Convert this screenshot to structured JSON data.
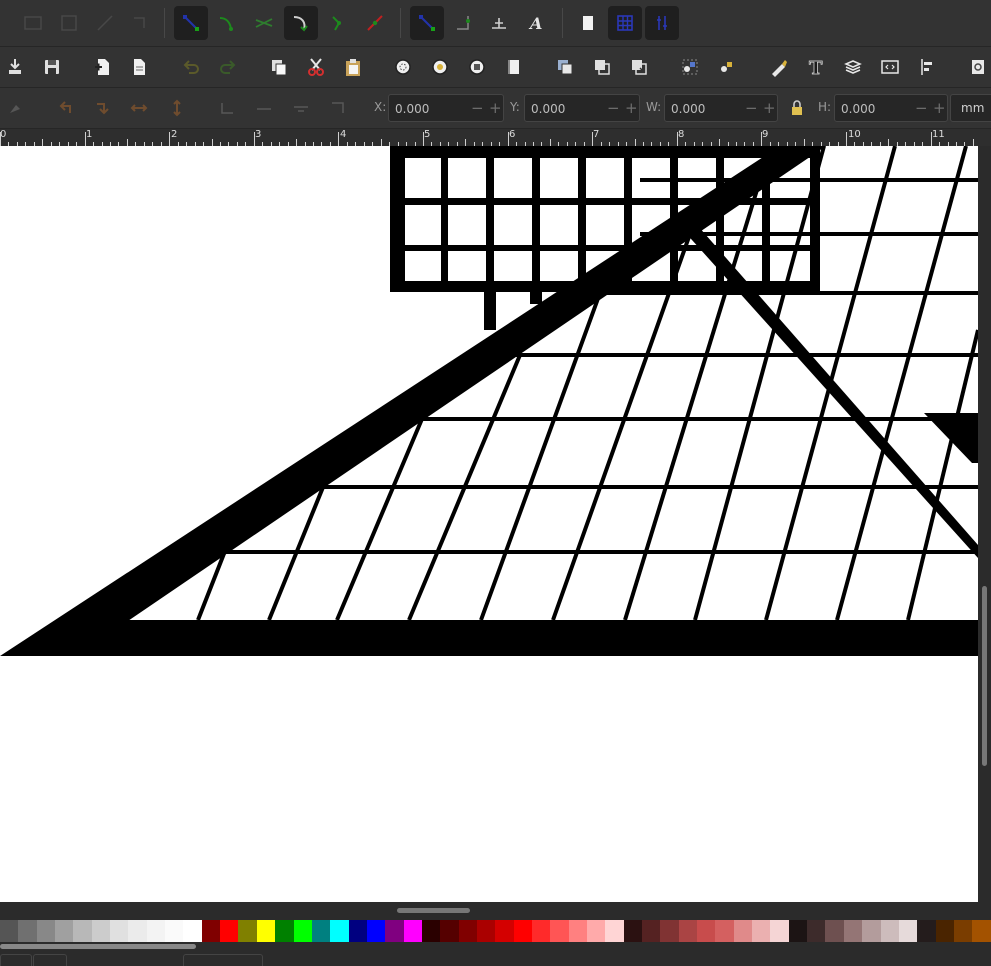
{
  "app": {
    "accent": "#1a237e"
  },
  "snap_toolbar": {
    "items": [
      {
        "icon": "snap-nodes-icon",
        "active": true
      },
      {
        "icon": "snap-smooth-icon",
        "active": false
      },
      {
        "icon": "snap-intersection-icon",
        "active": false
      },
      {
        "icon": "snap-path-icon",
        "active": true
      },
      {
        "icon": "snap-cusp-icon",
        "active": false
      },
      {
        "icon": "snap-midpoint-icon",
        "active": false
      },
      {
        "icon": "snap-bbox-icon",
        "active": true
      },
      {
        "icon": "snap-center-icon",
        "active": false
      },
      {
        "icon": "snap-rotation-center-icon",
        "active": false
      },
      {
        "icon": "snap-text-baseline-icon",
        "active": false
      },
      {
        "icon": "snap-page-icon",
        "active": false
      },
      {
        "icon": "snap-grid-icon",
        "active": true
      },
      {
        "icon": "snap-guide-icon",
        "active": true
      }
    ]
  },
  "command_toolbar": {
    "items": [
      "import-icon",
      "save-icon",
      "new-document-icon",
      "document-properties-icon",
      "undo-icon",
      "redo-icon",
      "copy-icon",
      "cut-icon",
      "paste-icon",
      "zoom-selection-icon",
      "zoom-drawing-icon",
      "zoom-page-icon",
      "zoom-page-width-icon",
      "duplicate-icon",
      "clone-icon",
      "unlink-clone-icon",
      "group-icon",
      "ungroup-icon",
      "fill-stroke-icon",
      "text-font-icon",
      "layers-icon",
      "xml-editor-icon",
      "align-distribute-icon",
      "preferences-icon"
    ]
  },
  "selector_toolbar": {
    "fields": [
      {
        "key": "x",
        "label": "X:",
        "value": "0.000"
      },
      {
        "key": "y",
        "label": "Y:",
        "value": "0.000"
      },
      {
        "key": "w",
        "label": "W:",
        "value": "0.000"
      },
      {
        "key": "h",
        "label": "H:",
        "value": "0.000"
      }
    ],
    "unit": "mm",
    "minus_label": "−",
    "plus_label": "+"
  },
  "ruler": {
    "labels": [
      "0",
      "1",
      "2",
      "3",
      "4",
      "5",
      "6",
      "7",
      "8",
      "9",
      "10",
      "11"
    ]
  },
  "palette": {
    "colors": [
      "#555555",
      "#707070",
      "#888888",
      "#a0a0a0",
      "#b8b8b8",
      "#cccccc",
      "#e0e0e0",
      "#ebebeb",
      "#f3f3f3",
      "#fafafa",
      "#ffffff",
      "#800000",
      "#ff0000",
      "#808000",
      "#ffff00",
      "#008000",
      "#00ff00",
      "#008080",
      "#00ffff",
      "#000080",
      "#0000ff",
      "#800080",
      "#ff00ff",
      "#2a0000",
      "#550000",
      "#800000",
      "#aa0000",
      "#d40000",
      "#ff0000",
      "#ff2a2a",
      "#ff5555",
      "#ff8080",
      "#ffaaaa",
      "#ffd5d5",
      "#2b1111",
      "#552222",
      "#803333",
      "#aa4444",
      "#c84c4c",
      "#d46060",
      "#e08a8a",
      "#ebb0b0",
      "#f5d5d5",
      "#1c1414",
      "#3d2b2b",
      "#6e5050",
      "#947575",
      "#b39c9c",
      "#cdbcbc",
      "#e6dada",
      "#241c1c",
      "#4a2400",
      "#7a3d00",
      "#a35200"
    ]
  }
}
